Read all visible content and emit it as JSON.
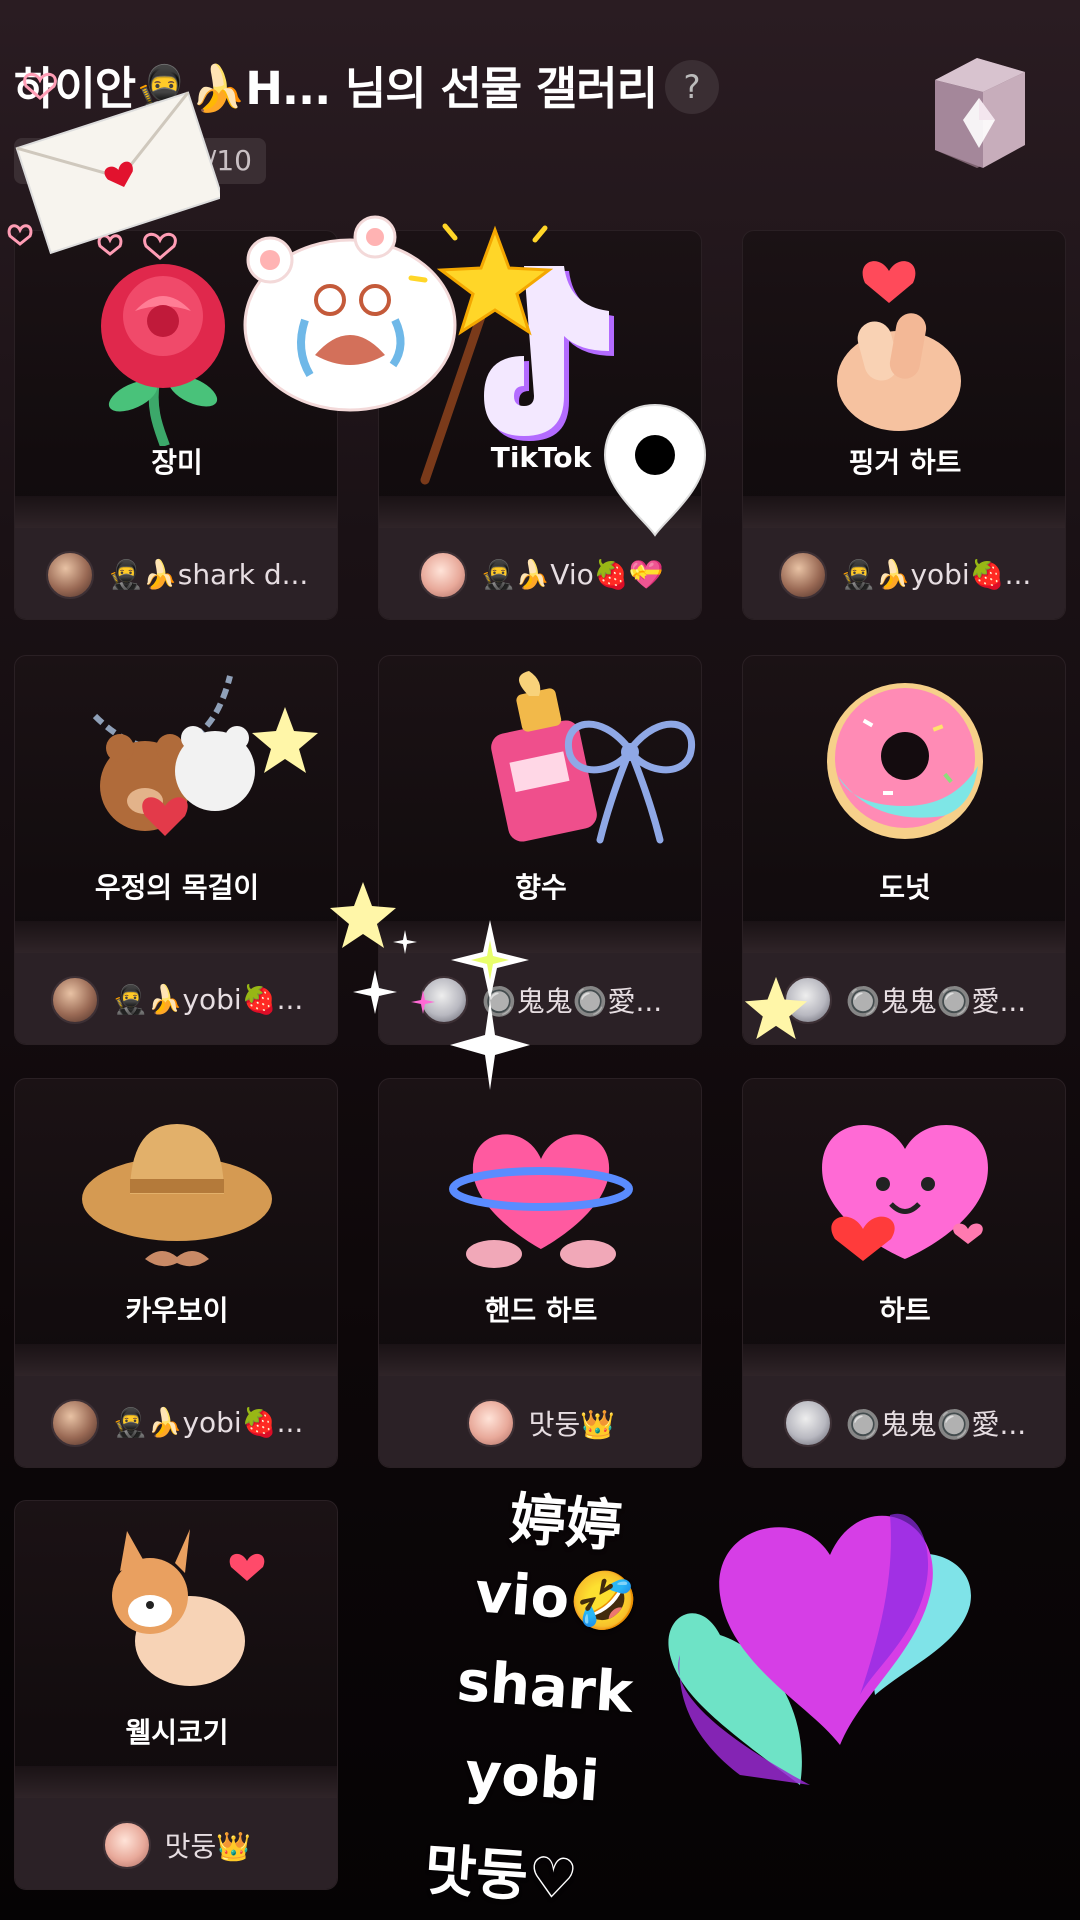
{
  "header": {
    "title": "하이안🥷🍌H... 님의 선물 갤러리",
    "help_label": "?",
    "counter": "5/10"
  },
  "cards": [
    {
      "name": "장미",
      "sender": "🥷🍌shark d..."
    },
    {
      "name": "TikTok",
      "sender": "🥷🍌Vio🍓💝"
    },
    {
      "name": "핑거 하트",
      "sender": "🥷🍌yobi🍓..."
    },
    {
      "name": "우정의 목걸이",
      "sender": "🥷🍌yobi🍓..."
    },
    {
      "name": "향수",
      "sender": "🔘鬼鬼🔘愛..."
    },
    {
      "name": "도넛",
      "sender": "🔘鬼鬼🔘愛..."
    },
    {
      "name": "카우보이",
      "sender": "🥷🍌yobi🍓..."
    },
    {
      "name": "핸드 하트",
      "sender": "맛둥👑"
    },
    {
      "name": "하트",
      "sender": "🔘鬼鬼🔘愛..."
    },
    {
      "name": "웰시코기",
      "sender": "맛둥👑"
    }
  ],
  "overlay_text": {
    "line1": "婷婷",
    "line2": "vio🤣",
    "line3": "shark",
    "line4": "yobi",
    "line5": "맛둥♡"
  },
  "colors": {
    "card_footer": "#2b2126",
    "background": "#0d0709",
    "heart_magenta": "#d63ee6",
    "heart_cyan": "#7fe3e8"
  }
}
